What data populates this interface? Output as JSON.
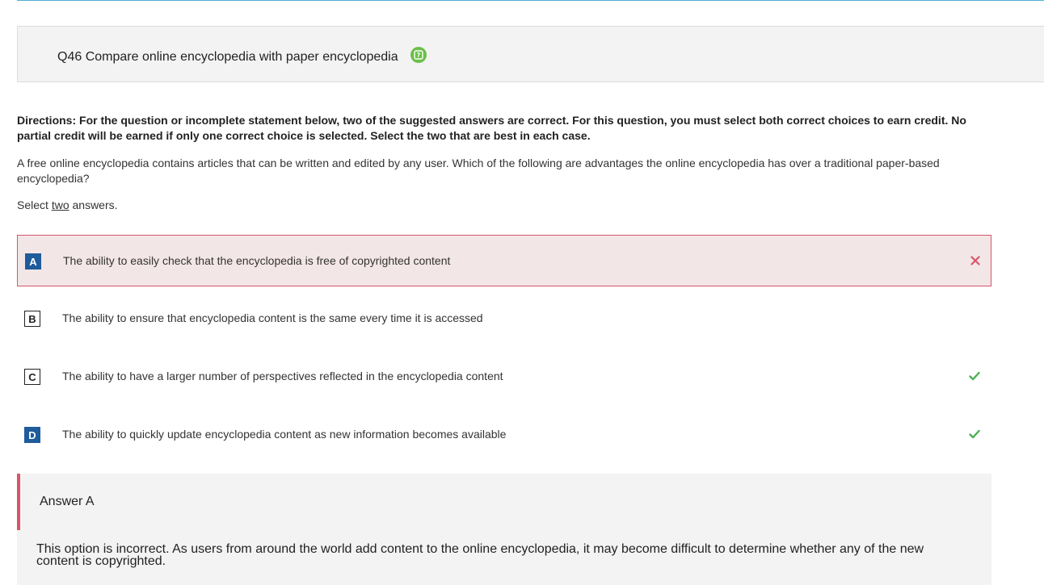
{
  "question": {
    "title": "Q46 Compare online encyclopedia with paper encyclopedia",
    "help_icon": "help-icon",
    "accent": "#6cbf4a"
  },
  "directions": "Directions: For the question or incomplete statement below, two of the suggested answers are correct. For this question, you must select both correct choices to earn credit. No partial credit will be earned if only one correct choice is selected. Select the two that are best in each case.",
  "stem": "A free online encyclopedia contains articles that can be written and edited by any user. Which of the following are advantages the online encyclopedia has over a traditional paper-based encyclopedia?",
  "select": {
    "prefix": "Select",
    "count": "two",
    "suffix": "answers."
  },
  "options": [
    {
      "letter": "A",
      "text": "The ability to easily check that the encyclopedia is free of copyrighted content",
      "selected": true,
      "result": "incorrect"
    },
    {
      "letter": "B",
      "text": "The ability to ensure that encyclopedia content is the same every time it is accessed",
      "selected": false,
      "result": "none"
    },
    {
      "letter": "C",
      "text": "The ability to have a larger number of perspectives reflected in the encyclopedia content",
      "selected": false,
      "result": "correct"
    },
    {
      "letter": "D",
      "text": "The ability to quickly update encyclopedia content as new information becomes available",
      "selected": true,
      "result": "correct"
    }
  ],
  "colors": {
    "selected_letter": "#1e5c9b",
    "incorrect": "#d9546a",
    "correct": "#4caf50"
  },
  "answer_feedback": {
    "title": "Answer A",
    "text": "This option is incorrect. As users from around the world add content to the online encyclopedia, it may become difficult to determine whether any of the new content is copyrighted."
  }
}
